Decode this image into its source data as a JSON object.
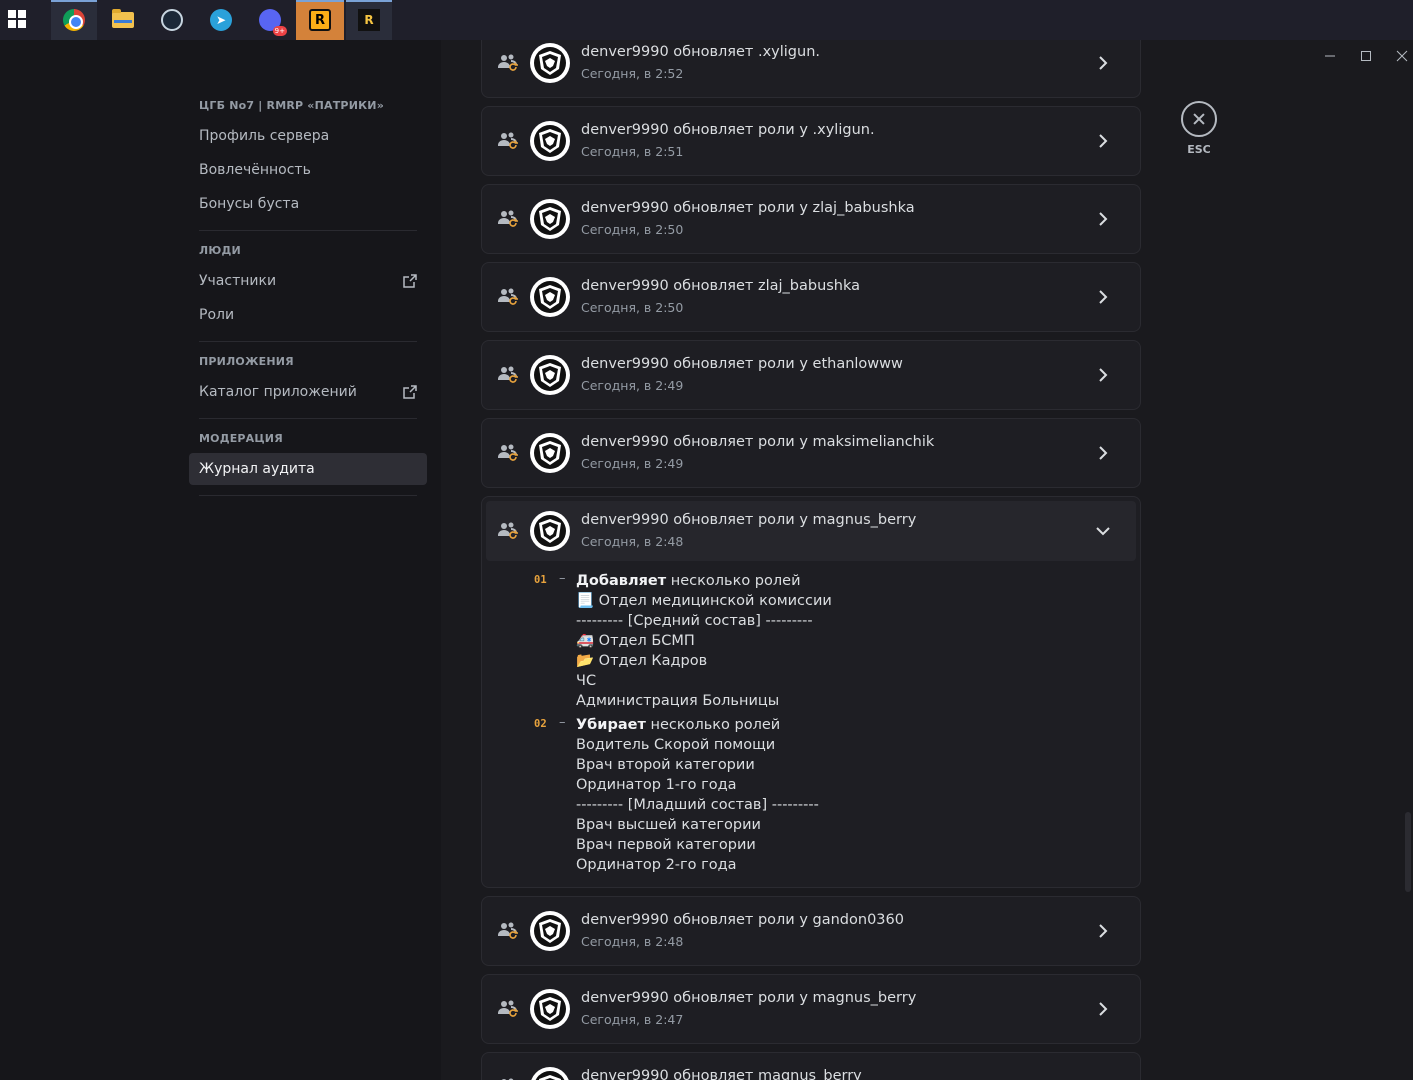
{
  "taskbar": {
    "icons": [
      "windows-start-icon",
      "chrome-icon",
      "file-explorer-icon",
      "steam-icon",
      "telegram-icon",
      "discord-icon",
      "rockstar-launcher-icon",
      "rage-mp-icon"
    ],
    "discord_badge": "9+",
    "rockstar_label": "R",
    "rage_label": "R"
  },
  "sidebar": {
    "server_header": "ЦГБ No7 | RMRP «ПАТРИКИ»",
    "server_items": [
      "Профиль сервера",
      "Вовлечённость",
      "Бонусы буста"
    ],
    "people_header": "ЛЮДИ",
    "people_items": [
      "Участники",
      "Роли"
    ],
    "apps_header": "ПРИЛОЖЕНИЯ",
    "apps_items": [
      "Каталог приложений"
    ],
    "moderation_header": "МОДЕРАЦИЯ",
    "moderation_items": [
      "Журнал аудита"
    ],
    "selected": "Журнал аудита"
  },
  "audit_log": {
    "entries": [
      {
        "title": "denver9990 обновляет .xyligun.",
        "time": "Сегодня, в 2:52"
      },
      {
        "title": "denver9990 обновляет роли у .xyligun.",
        "time": "Сегодня, в 2:51"
      },
      {
        "title": "denver9990 обновляет роли у zlaj_babushka",
        "time": "Сегодня, в 2:50"
      },
      {
        "title": "denver9990 обновляет zlaj_babushka",
        "time": "Сегодня, в 2:50"
      },
      {
        "title": "denver9990 обновляет роли у ethanlowww",
        "time": "Сегодня, в 2:49"
      },
      {
        "title": "denver9990 обновляет роли у maksimelianchik",
        "time": "Сегодня, в 2:49"
      },
      {
        "title": "denver9990 обновляет роли у magnus_berry",
        "time": "Сегодня, в 2:48"
      },
      {
        "title": "denver9990 обновляет роли у gandon0360",
        "time": "Сегодня, в 2:48"
      },
      {
        "title": "denver9990 обновляет роли у magnus_berry",
        "time": "Сегодня, в 2:47"
      },
      {
        "title": "denver9990 обновляет magnus_berry",
        "time": ""
      }
    ],
    "expanded": {
      "change1": {
        "num": "01",
        "dash": "–",
        "action": "Добавляет",
        "rest": " несколько ролей",
        "roles": [
          "📃 Отдел медицинской комиссии",
          "--------- [Средний состав] ---------",
          "🚑 Отдел БСМП",
          "📂 Отдел Кадров",
          "ЧС",
          "Администрация Больницы"
        ]
      },
      "change2": {
        "num": "02",
        "dash": "–",
        "action": "Убирает",
        "rest": " несколько ролей",
        "roles": [
          "Водитель Скорой помощи",
          "Врач второй категории",
          "Ординатор 1-го года",
          "--------- [Младший состав] ---------",
          "Врач высшей категории",
          "Врач первой категории",
          "Ординатор 2-го года"
        ]
      }
    }
  },
  "close": {
    "label": "ESC"
  },
  "colors": {
    "accent_number": "#e8a33d",
    "background": "#1a1a1e",
    "sidebar": "#16161a",
    "card": "#1e1e23"
  }
}
